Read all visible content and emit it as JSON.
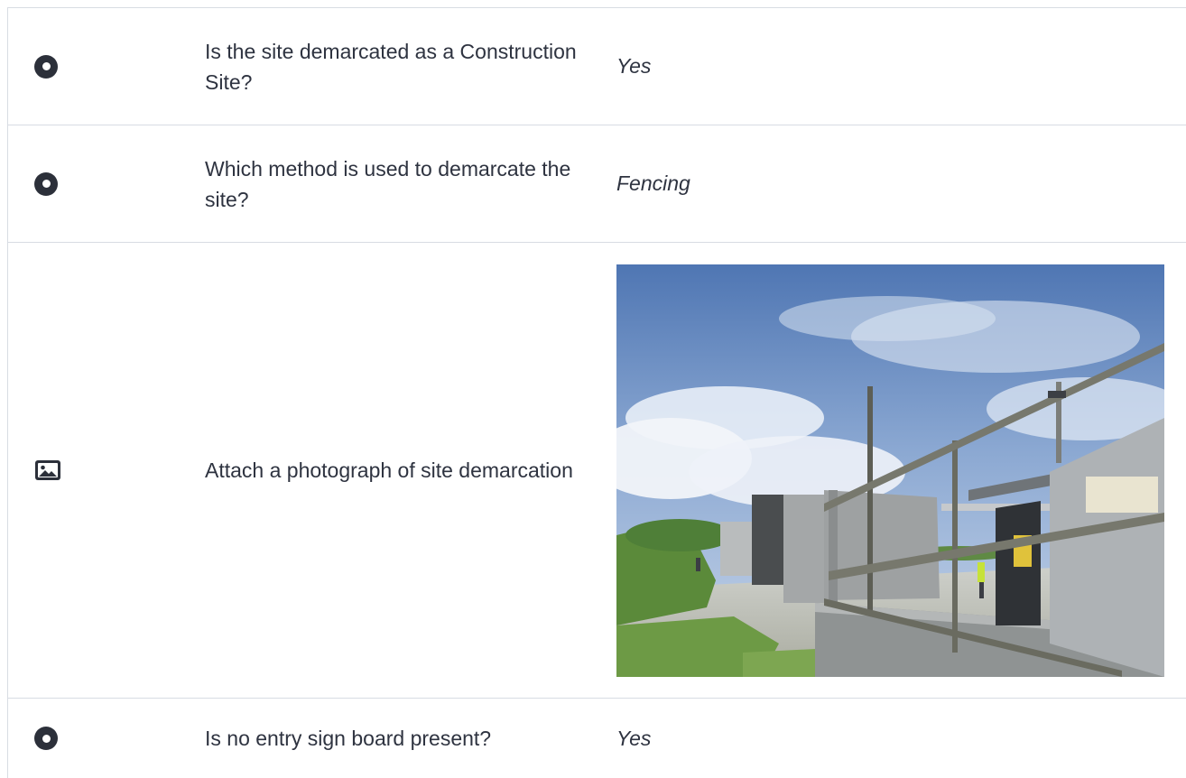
{
  "rows": [
    {
      "icon": "radio-icon",
      "question": "Is the site demarcated as a Construction Site?",
      "answer": "Yes"
    },
    {
      "icon": "radio-icon",
      "question": "Which method is used to demarcate the site?",
      "answer": "Fencing"
    },
    {
      "icon": "image-icon",
      "question": "Attach a photograph of site demarcation",
      "answer_photo": "site-demarcation-photo"
    },
    {
      "icon": "radio-icon",
      "question": "Is no entry sign board present?",
      "answer": "Yes"
    }
  ],
  "colors": {
    "border": "#d8dce3",
    "icon": "#2c303a",
    "text": "#2e3340"
  }
}
